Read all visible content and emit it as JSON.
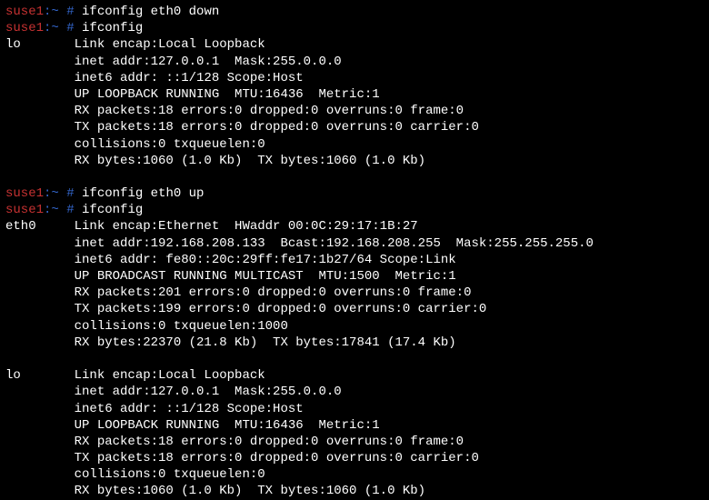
{
  "prompt": {
    "host": "suse1",
    "path": ":~ #"
  },
  "cmds": {
    "down": "ifconfig eth0 down",
    "show1": "ifconfig",
    "up": "ifconfig eth0 up",
    "show2": "ifconfig"
  },
  "lo1": {
    "name": "lo",
    "l1": "Link encap:Local Loopback",
    "l2": "inet addr:127.0.0.1  Mask:255.0.0.0",
    "l3": "inet6 addr: ::1/128 Scope:Host",
    "l4": "UP LOOPBACK RUNNING  MTU:16436  Metric:1",
    "l5": "RX packets:18 errors:0 dropped:0 overruns:0 frame:0",
    "l6": "TX packets:18 errors:0 dropped:0 overruns:0 carrier:0",
    "l7": "collisions:0 txqueuelen:0",
    "l8": "RX bytes:1060 (1.0 Kb)  TX bytes:1060 (1.0 Kb)"
  },
  "eth0": {
    "name": "eth0",
    "l1": "Link encap:Ethernet  HWaddr 00:0C:29:17:1B:27",
    "l2": "inet addr:192.168.208.133  Bcast:192.168.208.255  Mask:255.255.255.0",
    "l3": "inet6 addr: fe80::20c:29ff:fe17:1b27/64 Scope:Link",
    "l4": "UP BROADCAST RUNNING MULTICAST  MTU:1500  Metric:1",
    "l5": "RX packets:201 errors:0 dropped:0 overruns:0 frame:0",
    "l6": "TX packets:199 errors:0 dropped:0 overruns:0 carrier:0",
    "l7": "collisions:0 txqueuelen:1000",
    "l8": "RX bytes:22370 (21.8 Kb)  TX bytes:17841 (17.4 Kb)"
  },
  "lo2": {
    "name": "lo",
    "l1": "Link encap:Local Loopback",
    "l2": "inet addr:127.0.0.1  Mask:255.0.0.0",
    "l3": "inet6 addr: ::1/128 Scope:Host",
    "l4": "UP LOOPBACK RUNNING  MTU:16436  Metric:1",
    "l5": "RX packets:18 errors:0 dropped:0 overruns:0 frame:0",
    "l6": "TX packets:18 errors:0 dropped:0 overruns:0 carrier:0",
    "l7": "collisions:0 txqueuelen:0",
    "l8": "RX bytes:1060 (1.0 Kb)  TX bytes:1060 (1.0 Kb)"
  }
}
